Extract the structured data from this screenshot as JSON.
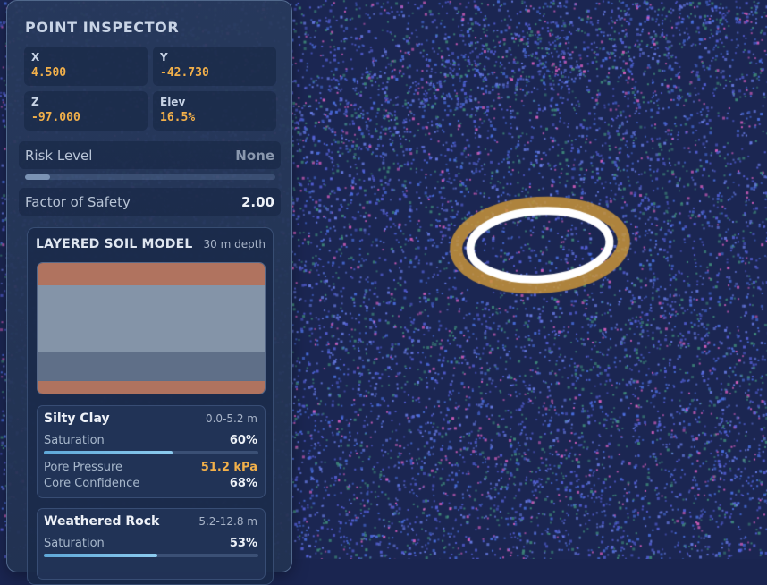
{
  "viewport": {
    "target_ring_colors": {
      "inner": "#ffffff",
      "outer": "#c8943a"
    },
    "point_colors": [
      "#5560d8",
      "#4a6fe0",
      "#3f8a7a",
      "#d85fc0",
      "#6a7ee8"
    ]
  },
  "inspector": {
    "title": "POINT INSPECTOR",
    "coords": [
      {
        "label": "X",
        "value": "4.500"
      },
      {
        "label": "Y",
        "value": "-42.730"
      },
      {
        "label": "Z",
        "value": "-97.000"
      },
      {
        "label": "Elev",
        "value": "16.5%"
      }
    ],
    "risk": {
      "label": "Risk Level",
      "value": "None",
      "level": 0.1
    },
    "factor_of_safety": {
      "label": "Factor of Safety",
      "value": "2.00"
    }
  },
  "soil_model": {
    "title": "LAYERED SOIL MODEL",
    "depth": "30 m depth",
    "column_layers": [
      {
        "color": "#b0735f",
        "fraction": 0.173
      },
      {
        "color": "#8494a8",
        "fraction": 0.507
      },
      {
        "color": "#5f6f88",
        "fraction": 0.227
      },
      {
        "color": "#b0735f",
        "fraction": 0.093
      }
    ],
    "layers": [
      {
        "name": "Silty Clay",
        "range": "0.0-5.2 m",
        "saturation_label": "Saturation",
        "saturation_value": "60%",
        "saturation_fraction": 0.6,
        "pore_label": "Pore Pressure",
        "pore_value": "51.2 kPa",
        "confidence_label": "Core Confidence",
        "confidence_value": "68%"
      },
      {
        "name": "Weathered Rock",
        "range": "5.2-12.8 m",
        "saturation_label": "Saturation",
        "saturation_value": "53%",
        "saturation_fraction": 0.53
      }
    ]
  },
  "colors": {
    "accent_value": "#f2b04a",
    "muted_value": "#8a98ae",
    "bright_value": "#eef2f8"
  }
}
